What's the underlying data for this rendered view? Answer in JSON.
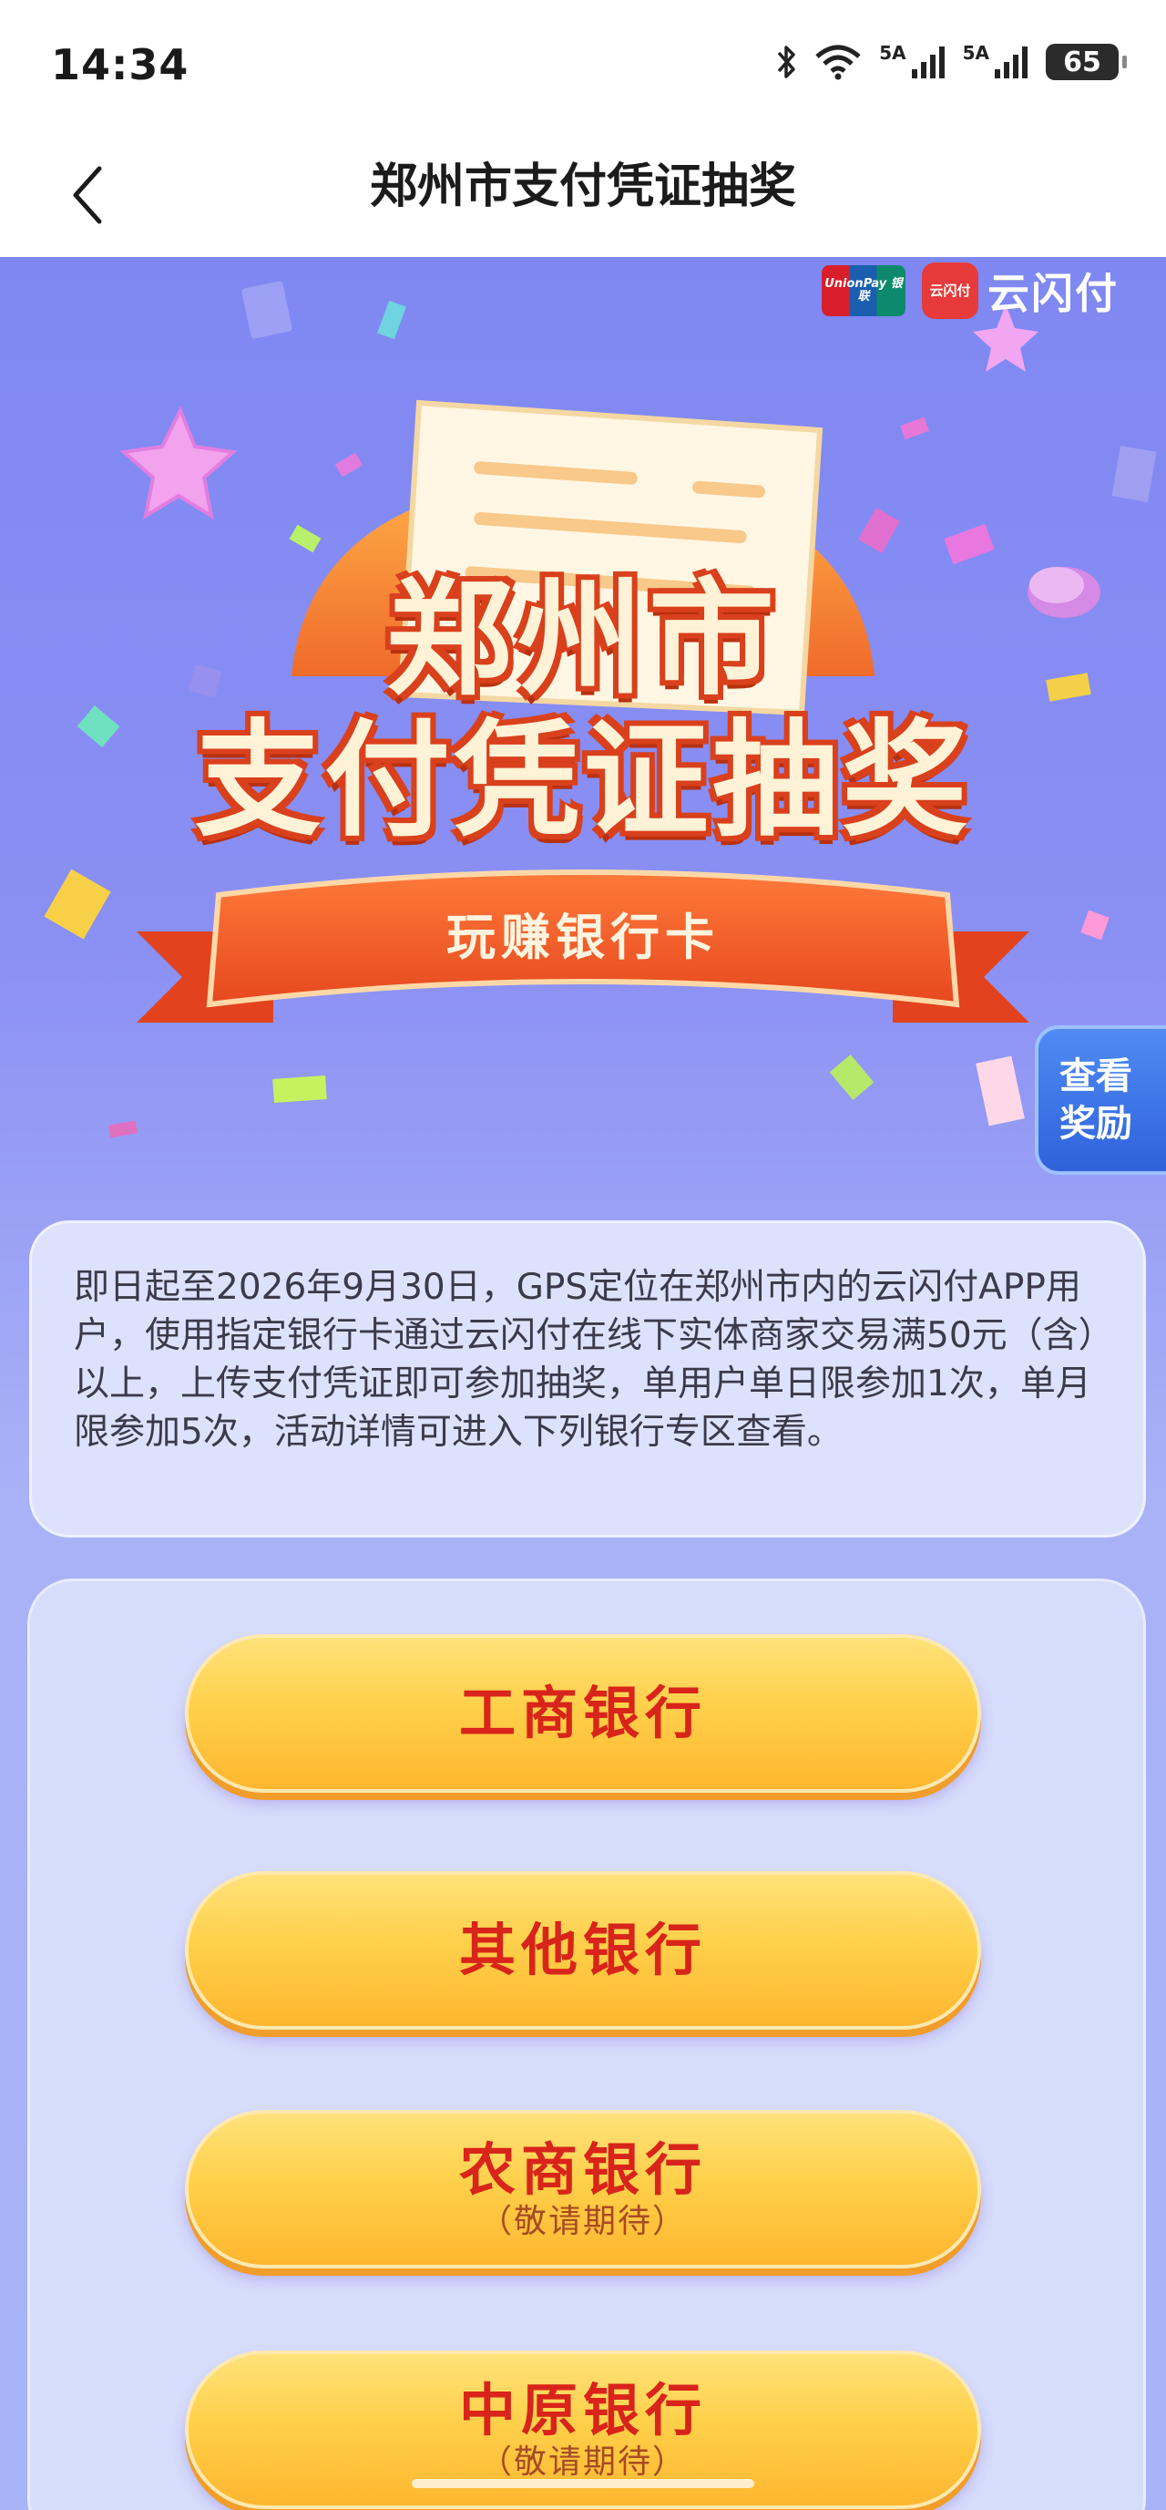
{
  "status_bar": {
    "time": "14:34",
    "net1": "5A",
    "net2": "5A",
    "battery": "65"
  },
  "nav": {
    "title": "郑州市支付凭证抽奖",
    "back_icon": "chevron-left-icon"
  },
  "banner": {
    "title_line1": "郑州市",
    "title_line2": "支付凭证抽奖",
    "ribbon_text": "玩赚银行卡",
    "unionpay_logo": "UnionPay 银联",
    "ysf_icon_text": "云闪付",
    "ysf_brand": "云闪付",
    "view_rewards_label": "查看 奖励"
  },
  "info": {
    "text": "即日起至2026年9月30日，GPS定位在郑州市内的云闪付APP用户，使用指定银行卡通过云闪付在线下实体商家交易满50元（含）以上，上传支付凭证即可参加抽奖，单用户单日限参加1次，单月限参加5次，活动详情可进入下列银行专区查看。"
  },
  "banks": [
    {
      "name": "工商银行",
      "sub": ""
    },
    {
      "name": "其他银行",
      "sub": ""
    },
    {
      "name": "农商银行",
      "sub": "（敬请期待）"
    },
    {
      "name": "中原银行",
      "sub": "（敬请期待）"
    }
  ],
  "colors": {
    "background_top": "#7f88f2",
    "bank_text": "#d8241a",
    "button_yellow": "#ffd04a",
    "rewards_blue": "#3b72e6"
  }
}
